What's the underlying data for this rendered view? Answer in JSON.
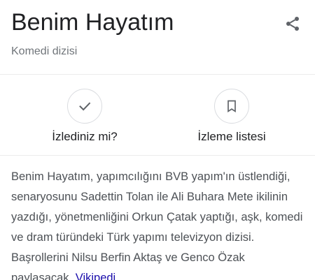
{
  "header": {
    "title": "Benim Hayatım",
    "subtitle": "Komedi dizisi",
    "share_icon": "share-icon"
  },
  "actions": [
    {
      "label": "İzlediniz mi?",
      "icon": "check-icon"
    },
    {
      "label": "İzleme listesi",
      "icon": "bookmark-icon"
    }
  ],
  "description": {
    "text": "Benim Hayatım, yapımcılığını BVB yapım'ın üstlendiği, senaryosunu Sadettin Tolan ile Ali Buhara Mete ikilinin yazdığı, yönetmenliğini Orkun Çatak yaptığı, aşk, komedi ve dram türündeki Türk yapımı televizyon dizisi. Başrollerini Nilsu Berfin Aktaş ve Genco Özak paylaşacak.",
    "source_link": "Vikipedi"
  },
  "colors": {
    "title": "#202124",
    "subtitle": "#70757a",
    "body_text": "#4d5156",
    "link": "#1a0dab",
    "icon": "#5f6368",
    "border": "#dadce0"
  }
}
